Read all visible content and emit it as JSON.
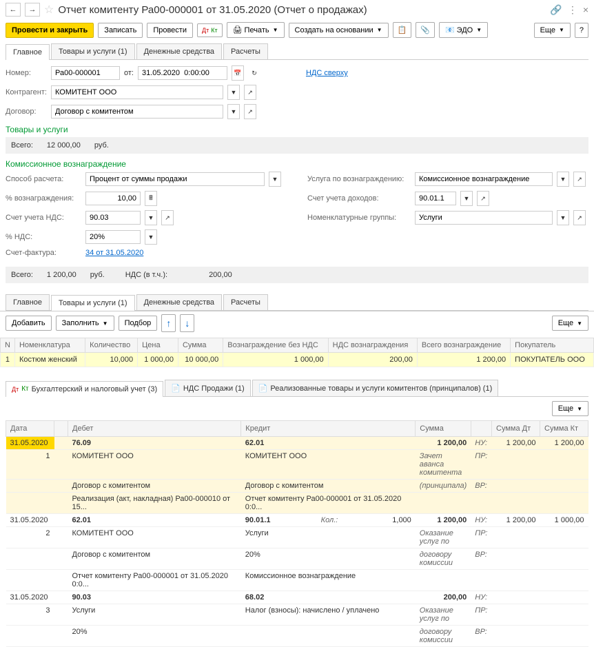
{
  "header": {
    "title": "Отчет комитенту Ра00-000001 от 31.05.2020 (Отчет о продажах)"
  },
  "toolbar": {
    "post_close": "Провести и закрыть",
    "save": "Записать",
    "post": "Провести",
    "print": "Печать",
    "create_based": "Создать на основании",
    "edo": "ЭДО",
    "more": "Еще"
  },
  "tabs1": {
    "main": "Главное",
    "goods": "Товары и услуги (1)",
    "money": "Денежные средства",
    "calc": "Расчеты"
  },
  "form": {
    "number_lbl": "Номер:",
    "number": "Ра00-000001",
    "from_lbl": "от:",
    "date": "31.05.2020  0:00:00",
    "vat_link": "НДС сверху",
    "counterparty_lbl": "Контрагент:",
    "counterparty": "КОМИТЕНТ ООО",
    "contract_lbl": "Договор:",
    "contract": "Договор с комитентом"
  },
  "goods": {
    "title": "Товары и услуги",
    "total_lbl": "Всего:",
    "total_val": "12 000,00",
    "currency": "руб."
  },
  "commission": {
    "title": "Комиссионное вознаграждение",
    "method_lbl": "Способ расчета:",
    "method": "Процент от суммы продажи",
    "service_lbl": "Услуга по вознаграждению:",
    "service": "Комиссионное вознаграждение",
    "percent_lbl": "% вознаграждения:",
    "percent": "10,00",
    "income_acc_lbl": "Счет учета доходов:",
    "income_acc": "90.01.1",
    "vat_acc_lbl": "Счет учета НДС:",
    "vat_acc": "90.03",
    "nomen_group_lbl": "Номенклатурные группы:",
    "nomen_group": "Услуги",
    "vat_rate_lbl": "% НДС:",
    "vat_rate": "20%",
    "invoice_lbl": "Счет-фактура:",
    "invoice_link": "34 от 31.05.2020"
  },
  "totals": {
    "total_lbl": "Всего:",
    "total": "1 200,00",
    "currency": "руб.",
    "vat_lbl": "НДС (в т.ч.):",
    "vat": "200,00"
  },
  "tabs2": {
    "main": "Главное",
    "goods": "Товары и услуги (1)",
    "money": "Денежные средства",
    "calc": "Расчеты"
  },
  "data_toolbar": {
    "add": "Добавить",
    "fill": "Заполнить",
    "pick": "Подбор",
    "more": "Еще"
  },
  "cols": {
    "n": "N",
    "nomen": "Номенклатура",
    "qty": "Количество",
    "price": "Цена",
    "sum": "Сумма",
    "fee_novat": "Вознаграждение без НДС",
    "fee_vat": "НДС вознаграждения",
    "fee_total": "Всего вознаграждение",
    "buyer": "Покупатель"
  },
  "row1": {
    "n": "1",
    "nomen": "Костюм женский",
    "qty": "10,000",
    "price": "1 000,00",
    "sum": "10 000,00",
    "fee_novat": "1 000,00",
    "fee_vat": "200,00",
    "fee_total": "1 200,00",
    "buyer": "ПОКУПАТЕЛЬ ООО"
  },
  "acc_tabs": {
    "t1": "Бухгалтерский и налоговый учет (3)",
    "t2": "НДС Продажи (1)",
    "t3": "Реализованные товары и услуги комитентов (принципалов) (1)"
  },
  "acc_more": "Еще",
  "acc_cols": {
    "date": "Дата",
    "debit": "Дебет",
    "credit": "Кредит",
    "sum": "Сумма",
    "sum_dt": "Сумма Дт",
    "sum_kt": "Сумма Кт"
  },
  "e1": {
    "date": "31.05.2020",
    "n": "1",
    "d_acc": "76.09",
    "d_l1": "КОМИТЕНТ ООО",
    "d_l2": "Договор с комитентом",
    "d_l3": "Реализация (акт, накладная) Ра00-000010 от 15...",
    "c_acc": "62.01",
    "c_l1": "КОМИТЕНТ ООО",
    "c_l2": "Договор с комитентом",
    "c_l3": "Отчет комитенту Ра00-000001 от 31.05.2020 0:0...",
    "sum": "1 200,00",
    "desc1": "Зачет аванса комитента",
    "desc2": "(принципала)",
    "nu": "НУ:",
    "pr": "ПР:",
    "vr": "ВР:",
    "dt": "1 200,00",
    "kt": "1 200,00"
  },
  "e2": {
    "date": "31.05.2020",
    "n": "2",
    "d_acc": "62.01",
    "d_l1": "КОМИТЕНТ ООО",
    "d_l2": "Договор с комитентом",
    "d_l3": "Отчет комитенту Ра00-000001 от 31.05.2020 0:0...",
    "c_acc": "90.01.1",
    "c_qty_lbl": "Кол.:",
    "c_qty": "1,000",
    "c_l1": "Услуги",
    "c_l2": "20%",
    "c_l3": "Комиссионное вознаграждение",
    "sum": "1 200,00",
    "desc1": "Оказание услуг по",
    "desc2": "договору комиссии",
    "dt": "1 200,00",
    "kt": "1 000,00"
  },
  "e3": {
    "date": "31.05.2020",
    "n": "3",
    "d_acc": "90.03",
    "d_l1": "Услуги",
    "d_l2": "20%",
    "c_acc": "68.02",
    "c_l1": "Налог (взносы): начислено / уплачено",
    "sum": "200,00",
    "desc1": "Оказание услуг по",
    "desc2": "договору комиссии"
  }
}
